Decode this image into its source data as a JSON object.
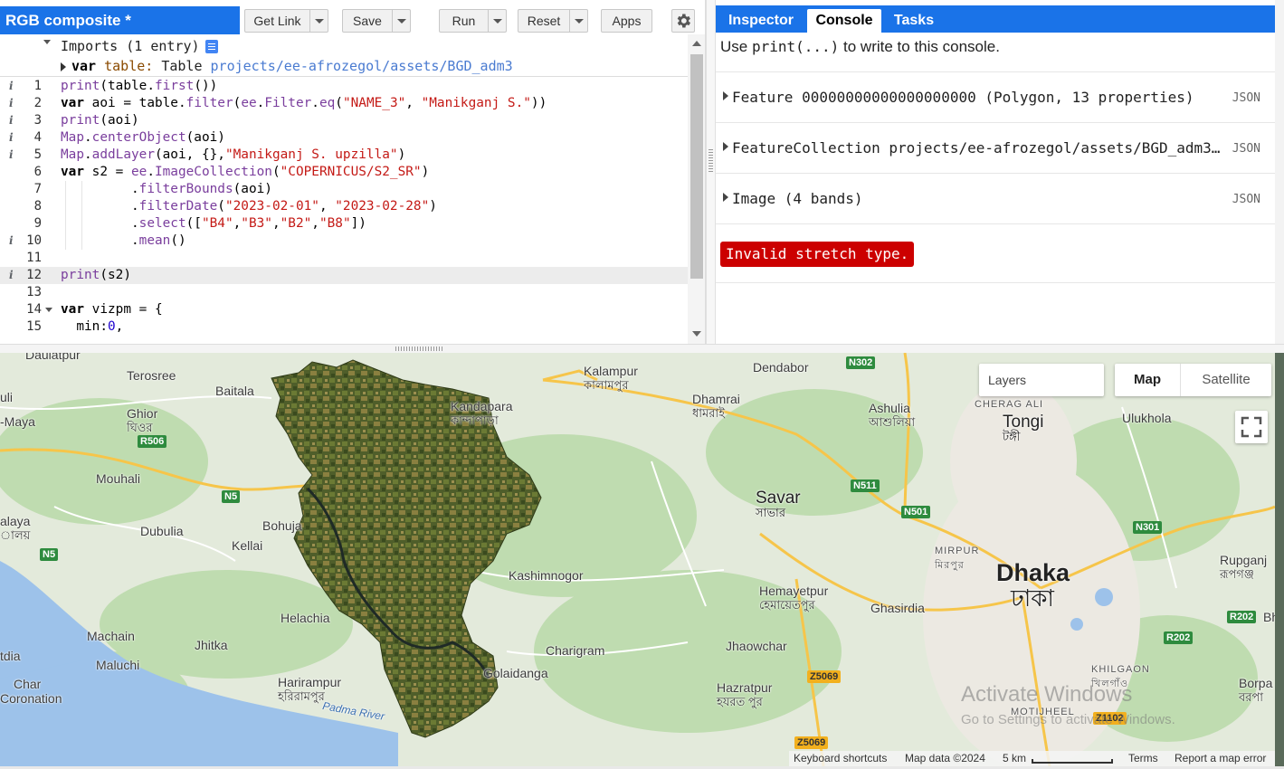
{
  "editor": {
    "script_title": "RGB composite *",
    "buttons": {
      "get_link": "Get Link",
      "save": "Save",
      "run": "Run",
      "reset": "Reset",
      "apps": "Apps"
    },
    "imports_header": "Imports (1 entry)",
    "import_entry": {
      "keyword": "var",
      "name": "table:",
      "type": "Table",
      "path": "projects/ee-afrozegol/assets/BGD_adm3"
    },
    "lines": [
      {
        "n": "1",
        "info": true
      },
      {
        "n": "2",
        "info": true
      },
      {
        "n": "3",
        "info": true
      },
      {
        "n": "4",
        "info": true
      },
      {
        "n": "5",
        "info": true
      },
      {
        "n": "6",
        "info": false
      },
      {
        "n": "7",
        "info": false
      },
      {
        "n": "8",
        "info": false
      },
      {
        "n": "9",
        "info": false
      },
      {
        "n": "10",
        "info": true
      },
      {
        "n": "11",
        "info": false
      },
      {
        "n": "12",
        "info": true
      },
      {
        "n": "13",
        "info": false
      },
      {
        "n": "14",
        "info": false
      },
      {
        "n": "15",
        "info": false
      }
    ],
    "code": {
      "l1": [
        "print",
        "(",
        "table",
        ".",
        "first",
        "())"
      ],
      "l2": [
        "var",
        " aoi = ",
        "table",
        ".",
        "filter",
        "(",
        "ee",
        ".",
        "Filter",
        ".",
        "eq",
        "(",
        "\"NAME_3\"",
        ", ",
        "\"Manikganj S.\"",
        "))"
      ],
      "l3": [
        "print",
        "(aoi)"
      ],
      "l4": [
        "Map",
        ".",
        "centerObject",
        "(aoi)"
      ],
      "l5": [
        "Map",
        ".",
        "addLayer",
        "(aoi, {},",
        "\"Manikganj S. upzilla\"",
        ")"
      ],
      "l6": [
        "var",
        " s2 = ",
        "ee",
        ".",
        "ImageCollection",
        "(",
        "\"COPERNICUS/S2_SR\"",
        ")"
      ],
      "l7": [
        ".",
        "filterBounds",
        "(aoi)"
      ],
      "l8": [
        ".",
        "filterDate",
        "(",
        "\"2023-02-01\"",
        ", ",
        "\"2023-02-28\"",
        ")"
      ],
      "l9": [
        ".",
        "select",
        "([",
        "\"B4\"",
        ",",
        "\"B3\"",
        ",",
        "\"B2\"",
        ",",
        "\"B8\"",
        "])"
      ],
      "l10": [
        ".",
        "mean",
        "()"
      ],
      "l12": [
        "print",
        "(s2)"
      ],
      "l14": [
        "var",
        " vizpm = {"
      ],
      "l15": [
        "  min:",
        "0",
        ","
      ]
    }
  },
  "right_panel": {
    "tabs": {
      "inspector": "Inspector",
      "console": "Console",
      "tasks": "Tasks"
    },
    "hint_pre": "Use ",
    "hint_code": "print(...)",
    "hint_post": " to write to this console.",
    "rows": [
      {
        "text": "Feature 00000000000000000000 (Polygon, 13 properties)",
        "badge": "JSON"
      },
      {
        "text": "FeatureCollection projects/ee-afrozegol/assets/BGD_adm3…",
        "badge": "JSON"
      },
      {
        "text": "Image (4 bands)",
        "badge": "JSON"
      }
    ],
    "error": "Invalid stretch type."
  },
  "map": {
    "controls": {
      "layers": "Layers",
      "map": "Map",
      "satellite": "Satellite"
    },
    "places": {
      "daulatpur": "Daulatpur",
      "terosree": "Terosree",
      "baitala": "Baitala",
      "uli": "uli",
      "maya": "-Maya",
      "ghior": "Ghior",
      "ghior_bn": "ঘিওর",
      "mouhali": "Mouhali",
      "alaya": "alaya",
      "alaya_bn": "ালয়",
      "dubulia": "Dubulia",
      "bohuja": "Bohuja",
      "kellai": "Kellai",
      "helachia": "Helachia",
      "machain": "Machain",
      "jhitka": "Jhitka",
      "maluchi": "Maluchi",
      "char": "Char",
      "coronation": "Coronation",
      "tdia": "tdia",
      "harirampur": "Harirampur",
      "harirampur_bn": "হরিরামপুর",
      "kalampur": "Kalampur",
      "kalampur_bn": "কালামপুর",
      "kandapara": "Kandapara",
      "kandapara_bn": "কান্দাপাড়া",
      "dhamrai": "Dhamrai",
      "dhamrai_bn": "ধামরাই",
      "dendabor": "Dendabor",
      "ashulia": "Ashulia",
      "ashulia_bn": "আশুলিয়া",
      "cherag_ali": "CHERAG ALI",
      "tongi": "Tongi",
      "tongi_bn": "টঙ্গী",
      "ulukhola": "Ulukhola",
      "savar": "Savar",
      "savar_bn": "সাভার",
      "kashimnogor": "Kashimnogor",
      "hemayetpur": "Hemayetpur",
      "hemayetpur_bn": "হেমায়েতপুর",
      "ghasirdia": "Ghasirdia",
      "mirpur": "MIRPUR",
      "mirpur_bn": "মিরপুর",
      "dhaka": "Dhaka",
      "dhaka_bn": "ঢাকা",
      "rupganj": "Rupganj",
      "rupganj_bn": "রূপগঞ্জ",
      "charigram": "Charigram",
      "golaidanga": "Golaidanga",
      "jhaowchar": "Jhaowchar",
      "hazratpur": "Hazratpur",
      "hazratpur_bn": "হযরত পুর",
      "khilgaon": "KHILGAON",
      "khilgaon_bn": "খিলগাঁও",
      "motijheel": "MOTIJHEEL",
      "borpa": "Borpa",
      "borpa_bn": "বরপা",
      "bh": "Bh",
      "padma": "Padma River"
    },
    "shields": {
      "r506": "R506",
      "n5a": "N5",
      "n5b": "N5",
      "n302": "N302",
      "n511": "N511",
      "n501": "N501",
      "n301": "N301",
      "r202a": "R202",
      "r202b": "R202",
      "z5069a": "Z5069",
      "z5069b": "Z5069",
      "z1102": "Z1102"
    },
    "attribution": {
      "shortcuts": "Keyboard shortcuts",
      "data": "Map data ©2024",
      "scale": "5 km",
      "terms": "Terms",
      "report": "Report a map error"
    },
    "watermark": {
      "line1": "Activate Windows",
      "line2": "Go to Settings to activate Windows."
    }
  },
  "colors": {
    "accent": "#1a73e8",
    "error": "#cc0000",
    "string": "#c41a16",
    "function": "#7a3e9d",
    "number": "#1c00cf"
  }
}
